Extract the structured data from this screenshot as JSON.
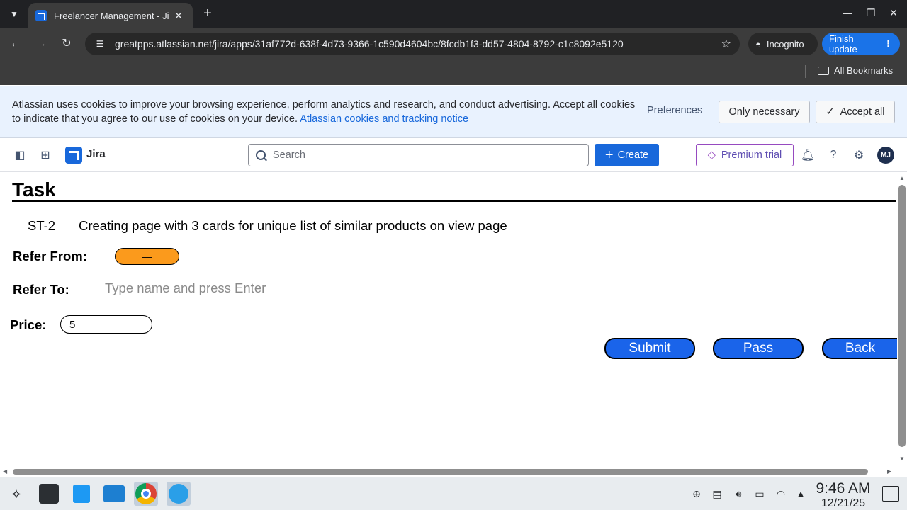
{
  "browser": {
    "tab_title": "Freelancer Management - Ji",
    "url": "greatpps.atlassian.net/jira/apps/31af772d-638f-4d73-9366-1c590d4604bc/8fcdb1f3-dd57-4804-8792-c1c8092e5120",
    "incognito_label": "Incognito",
    "finish_update_label": "Finish update",
    "all_bookmarks_label": "All Bookmarks"
  },
  "cookie_banner": {
    "text": "Atlassian uses cookies to improve your browsing experience, perform analytics and research, and conduct advertising. Accept all cookies to indicate that you agree to our use of cookies on your device. ",
    "link_text": "Atlassian cookies and tracking notice",
    "preferences_label": "Preferences",
    "only_necessary_label": "Only necessary",
    "accept_all_label": "Accept all"
  },
  "jira_header": {
    "app_name": "Jira",
    "search_placeholder": "Search",
    "create_label": "Create",
    "premium_label": "Premium trial",
    "avatar_initials": "MJ"
  },
  "task": {
    "title": "Task",
    "issue_key": "ST-2",
    "summary": "Creating page with 3 cards for unique list of similar products on view page",
    "refer_from_label": "Refer From:",
    "refer_from_value": "—",
    "refer_to_label": "Refer To:",
    "refer_to_placeholder": "Type name and press Enter",
    "price_label": "Price:",
    "price_value": "5",
    "buttons": {
      "submit": "Submit",
      "pass": "Pass",
      "back": "Back"
    }
  },
  "taskbar": {
    "time": "9:46 AM",
    "date": "12/21/25"
  },
  "colors": {
    "accent_blue": "#1868db",
    "refer_from_orange": "#fb9a1c",
    "action_button_blue": "#1a64ea",
    "cookie_bg": "#e9f2fe",
    "premium_purple": "#964ac0"
  }
}
